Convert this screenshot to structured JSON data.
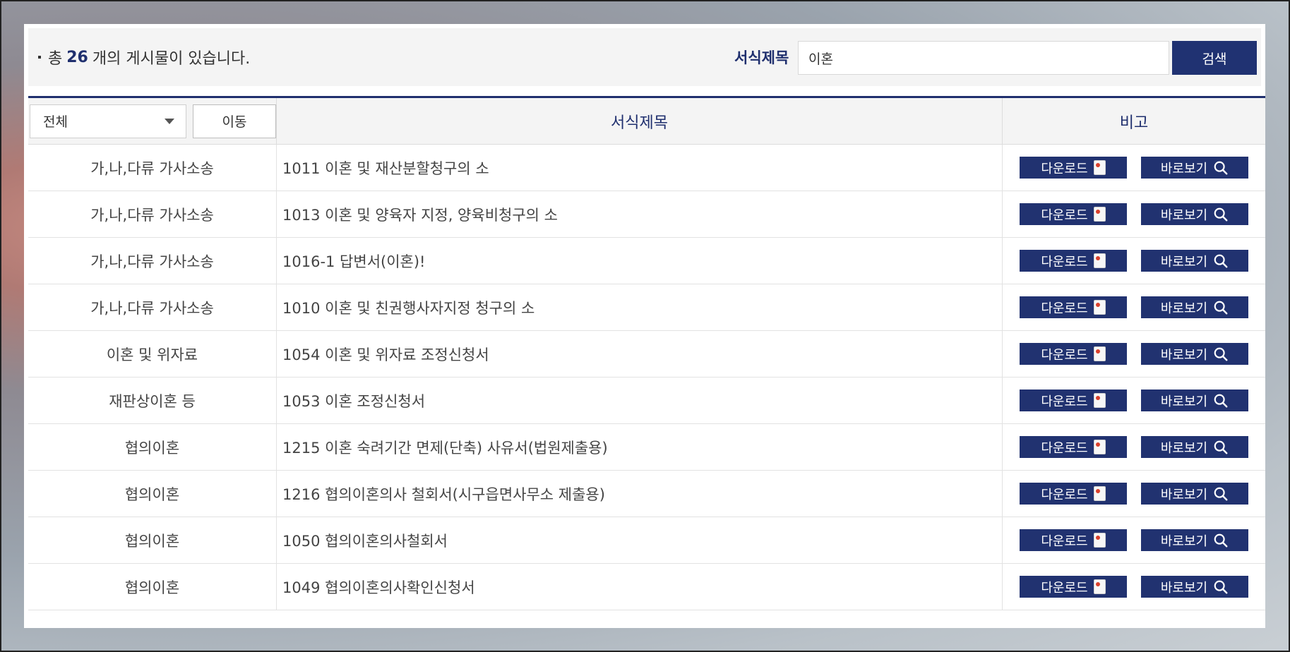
{
  "summary": {
    "prefix": "총",
    "count": "26",
    "suffix": "개의 게시물이 있습니다."
  },
  "search": {
    "label": "서식제목",
    "value": "이혼",
    "button_label": "검색"
  },
  "table": {
    "filter_value": "전체",
    "move_label": "이동",
    "col_title": "서식제목",
    "col_note": "비고",
    "download_label": "다운로드",
    "view_label": "바로보기",
    "rows": [
      {
        "category": "가,나,다류 가사소송",
        "title": "1011 이혼 및 재산분할청구의 소"
      },
      {
        "category": "가,나,다류 가사소송",
        "title": "1013 이혼 및 양육자 지정, 양육비청구의 소"
      },
      {
        "category": "가,나,다류 가사소송",
        "title": "1016-1 답변서(이혼)!"
      },
      {
        "category": "가,나,다류 가사소송",
        "title": "1010 이혼 및 친권행사자지정 청구의 소"
      },
      {
        "category": "이혼 및 위자료",
        "title": "1054 이혼 및 위자료 조정신청서"
      },
      {
        "category": "재판상이혼 등",
        "title": "1053 이혼 조정신청서"
      },
      {
        "category": "협의이혼",
        "title": "1215 이혼 숙려기간 면제(단축) 사유서(법원제출용)"
      },
      {
        "category": "협의이혼",
        "title": "1216 협의이혼의사 철회서(시구읍면사무소 제출용)"
      },
      {
        "category": "협의이혼",
        "title": "1050 협의이혼의사철회서"
      },
      {
        "category": "협의이혼",
        "title": "1049 협의이혼의사확인신청서"
      }
    ]
  },
  "icons": {
    "download": "document-icon",
    "view": "magnifier-icon",
    "select": "chevron-down-icon"
  },
  "colors": {
    "accent": "#203272"
  }
}
